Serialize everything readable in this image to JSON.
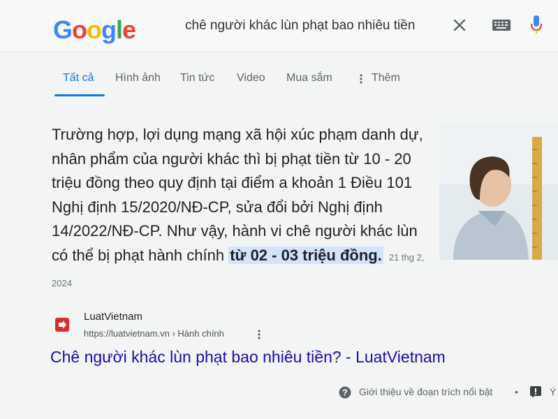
{
  "logo": {
    "letters": [
      "G",
      "o",
      "o",
      "g",
      "l",
      "e"
    ]
  },
  "search": {
    "query": "chê người khác lùn phạt bao nhiêu tiền"
  },
  "icons": {
    "clear": "close-icon",
    "keyboard": "keyboard-icon",
    "voice": "mic-icon",
    "more": "more-vert-icon",
    "help": "help-circle-icon",
    "feedback": "flag-icon"
  },
  "tabs": [
    {
      "label": "Tất cả",
      "active": true
    },
    {
      "label": "Hình ảnh"
    },
    {
      "label": "Tin tức"
    },
    {
      "label": "Video"
    },
    {
      "label": "Mua sắm"
    },
    {
      "label": "Thêm"
    }
  ],
  "snippet": {
    "text_before": "Trường hợp, lợi dụng mạng xã hội xúc phạm danh dự, nhân phẩm của người khác thì bị phạt tiền từ 10 - 20 triệu đồng theo quy định tại điểm a khoản 1 Điều 101 Nghị định 15/2020/NĐ-CP, sửa đổi bởi Nghị định 14/2022/NĐ-CP. Như vậy, hành vi chê người khác lùn có thể bị phạt hành chính ",
    "highlight": "từ 02 - 03 triệu đồng.",
    "date": "21 thg 2, 2024"
  },
  "result": {
    "site_name": "LuatVietnam",
    "url": "https://luatvietnam.vn › Hành chính",
    "title": "Chê người khác lùn phạt bao nhiêu tiền? - LuatVietnam"
  },
  "footer": {
    "about": "Giới thiệu về đoạn trích nổi bật",
    "separator": "•",
    "feedback": "Ý"
  },
  "colors": {
    "link": "#1a0dab",
    "accent": "#1a73e8",
    "highlight": "#d2e3fc"
  }
}
